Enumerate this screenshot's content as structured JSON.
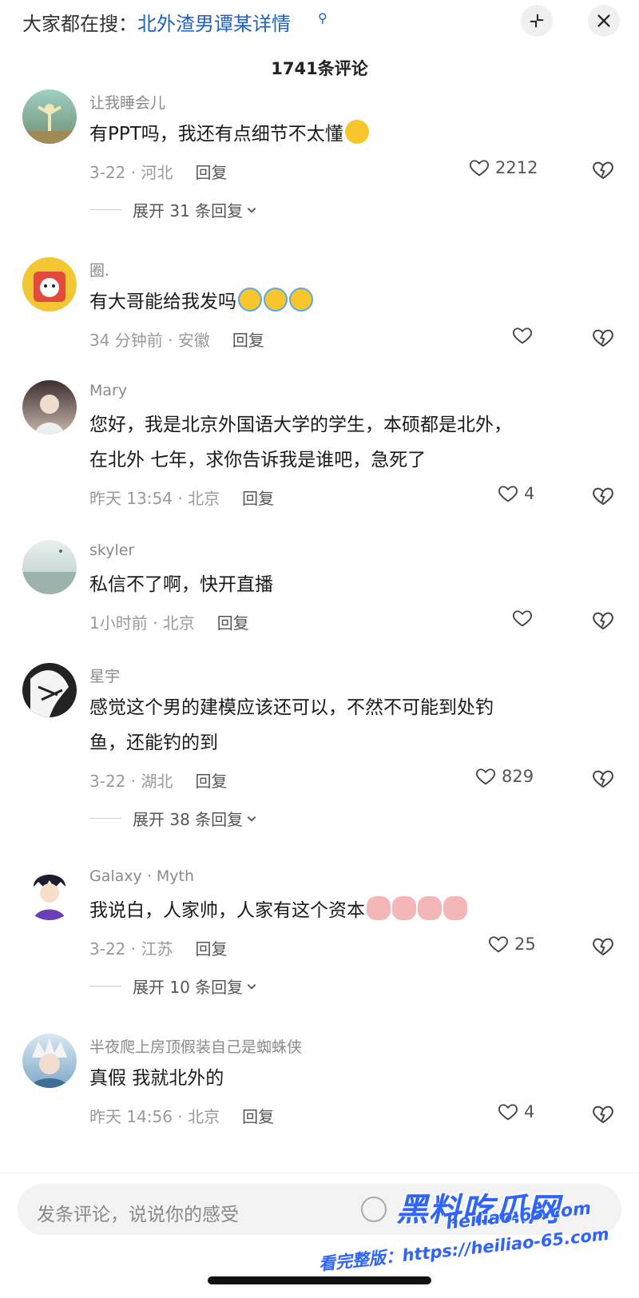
{
  "search": {
    "prefix": "大家都在搜：",
    "term": "北外渣男谭某详情"
  },
  "header": {
    "comment_count": "1741条评论"
  },
  "comments": [
    {
      "username": "让我睡会儿",
      "lines": [
        "有PPT吗，我还有点细节不太懂"
      ],
      "emoji": [
        "smile"
      ],
      "meta": "3-22 · 河北",
      "reply_label": "回复",
      "likes": "2212",
      "expand": "展开 31 条回复"
    },
    {
      "username": "圈.",
      "lines": [
        "有大哥能给我发吗"
      ],
      "emoji": [
        "cry",
        "cry",
        "cry"
      ],
      "meta": "34 分钟前 · 安徽",
      "reply_label": "回复",
      "likes": ""
    },
    {
      "username": "Mary",
      "lines": [
        "您好，我是北京外国语大学的学生，本硕都是北外，",
        "在北外 七年，求你告诉我是谁吧，急死了"
      ],
      "meta": "昨天 13:54 · 北京",
      "reply_label": "回复",
      "likes": "4"
    },
    {
      "username": "skyler",
      "lines": [
        "私信不了啊，快开直播"
      ],
      "meta": "1小时前 · 北京",
      "reply_label": "回复",
      "likes": ""
    },
    {
      "username": "星宇",
      "lines": [
        "感觉这个男的建模应该还可以，不然不可能到处钓",
        "鱼，还能钓的到"
      ],
      "meta": "3-22 · 湖北",
      "reply_label": "回复",
      "likes": "829",
      "expand": "展开 38 条回复"
    },
    {
      "username": "Galaxy · Myth",
      "lines": [
        "我说白，人家帅，人家有这个资本"
      ],
      "emoji": [
        "pig",
        "pig",
        "pig",
        "pig"
      ],
      "meta": "3-22 · 江苏",
      "reply_label": "回复",
      "likes": "25",
      "expand": "展开 10 条回复"
    },
    {
      "username": "半夜爬上房顶假装自己是蜘蛛侠",
      "lines": [
        "真假 我就北外的"
      ],
      "meta": "昨天 14:56 · 北京",
      "reply_label": "回复",
      "likes": "4"
    }
  ],
  "input": {
    "placeholder": "发条评论，说说你的感受"
  },
  "watermark": {
    "main": "黑料吃瓜网",
    "site": "heiliao-65.com",
    "sub": "看完整版：https://heiliao-65.com"
  },
  "colors": {
    "link": "#1f5fbf",
    "watermark": "#2f63ff",
    "muted": "#9a9a9a"
  }
}
